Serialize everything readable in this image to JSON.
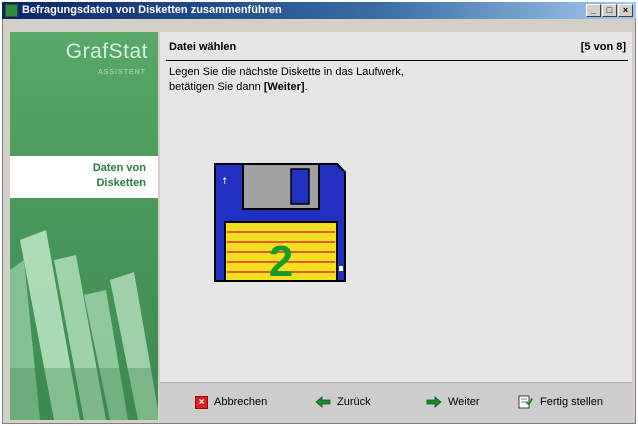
{
  "window": {
    "title": "Befragungsdaten von Disketten zusammenführen"
  },
  "titlebar_buttons": {
    "minimize": "_",
    "maximize": "□",
    "close": "×"
  },
  "sidebar": {
    "brand": "GrafStat",
    "subtitle": "ASSISTENT",
    "step_line1": "Daten von",
    "step_line2": "Disketten"
  },
  "header": {
    "title": "Datei wählen",
    "step": "[5 von 8]"
  },
  "instruction": {
    "line1": "Legen Sie die nächste Diskette in das Laufwerk,",
    "line2_prefix": "betätigen Sie dann ",
    "line2_bold": "[Weiter]",
    "line2_suffix": "."
  },
  "disk": {
    "number": "2"
  },
  "buttons": {
    "cancel": "Abbrechen",
    "back": "Zurück",
    "next": "Weiter",
    "finish": "Fertig stellen"
  },
  "icons": {
    "cancel": "x-icon",
    "back": "arrow-left-icon",
    "next": "arrow-right-icon",
    "finish": "document-check-icon"
  },
  "colors": {
    "brand_green": "#4a9a5c",
    "disk_blue": "#2030c0",
    "disk_label": "#f5e020",
    "disk_number": "#1a9a2a"
  }
}
